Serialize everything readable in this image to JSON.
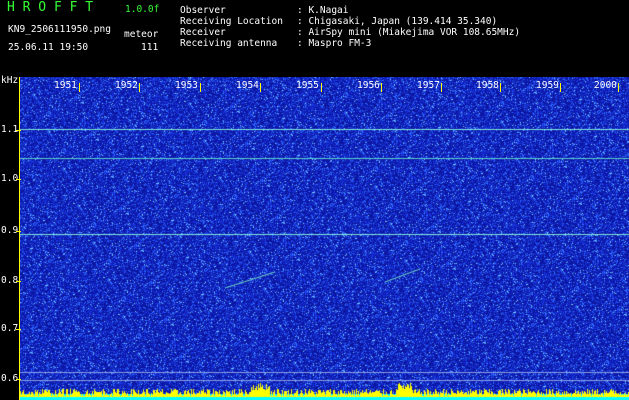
{
  "header": {
    "title_letters": "H R O F F T",
    "version": "1.0.0f",
    "filename": "KN9_2506111950.png",
    "mode": "meteor",
    "datetime": "25.06.11 19:50",
    "count": "111"
  },
  "info": {
    "observer_label": "Observer",
    "observer_value": ": K.Nagai",
    "location_label": "Receiving Location",
    "location_value": ": Chigasaki, Japan (139.414 35.340)",
    "receiver_label": "Receiver",
    "receiver_value": ": AirSpy mini (Miakejima VOR 108.65MHz)",
    "antenna_label": "Receiving antenna",
    "antenna_value": ": Maspro FM-3"
  },
  "axis": {
    "y_unit": "kHz",
    "y_ticks": [
      "1.1",
      "1.0",
      "0.9",
      "0.8",
      "0.7",
      "0.6"
    ],
    "x_ticks": [
      "1951",
      "1952",
      "1953",
      "1954",
      "1955",
      "1956",
      "1957",
      "1958",
      "1959",
      "2000"
    ]
  },
  "colors": {
    "background": "#000000",
    "waterfall_base": "#1020a8",
    "noise_bright": "#3a7cff",
    "signal_line": "#40e0d0",
    "axis": "#ffff00",
    "title_green": "#35ff35"
  }
}
